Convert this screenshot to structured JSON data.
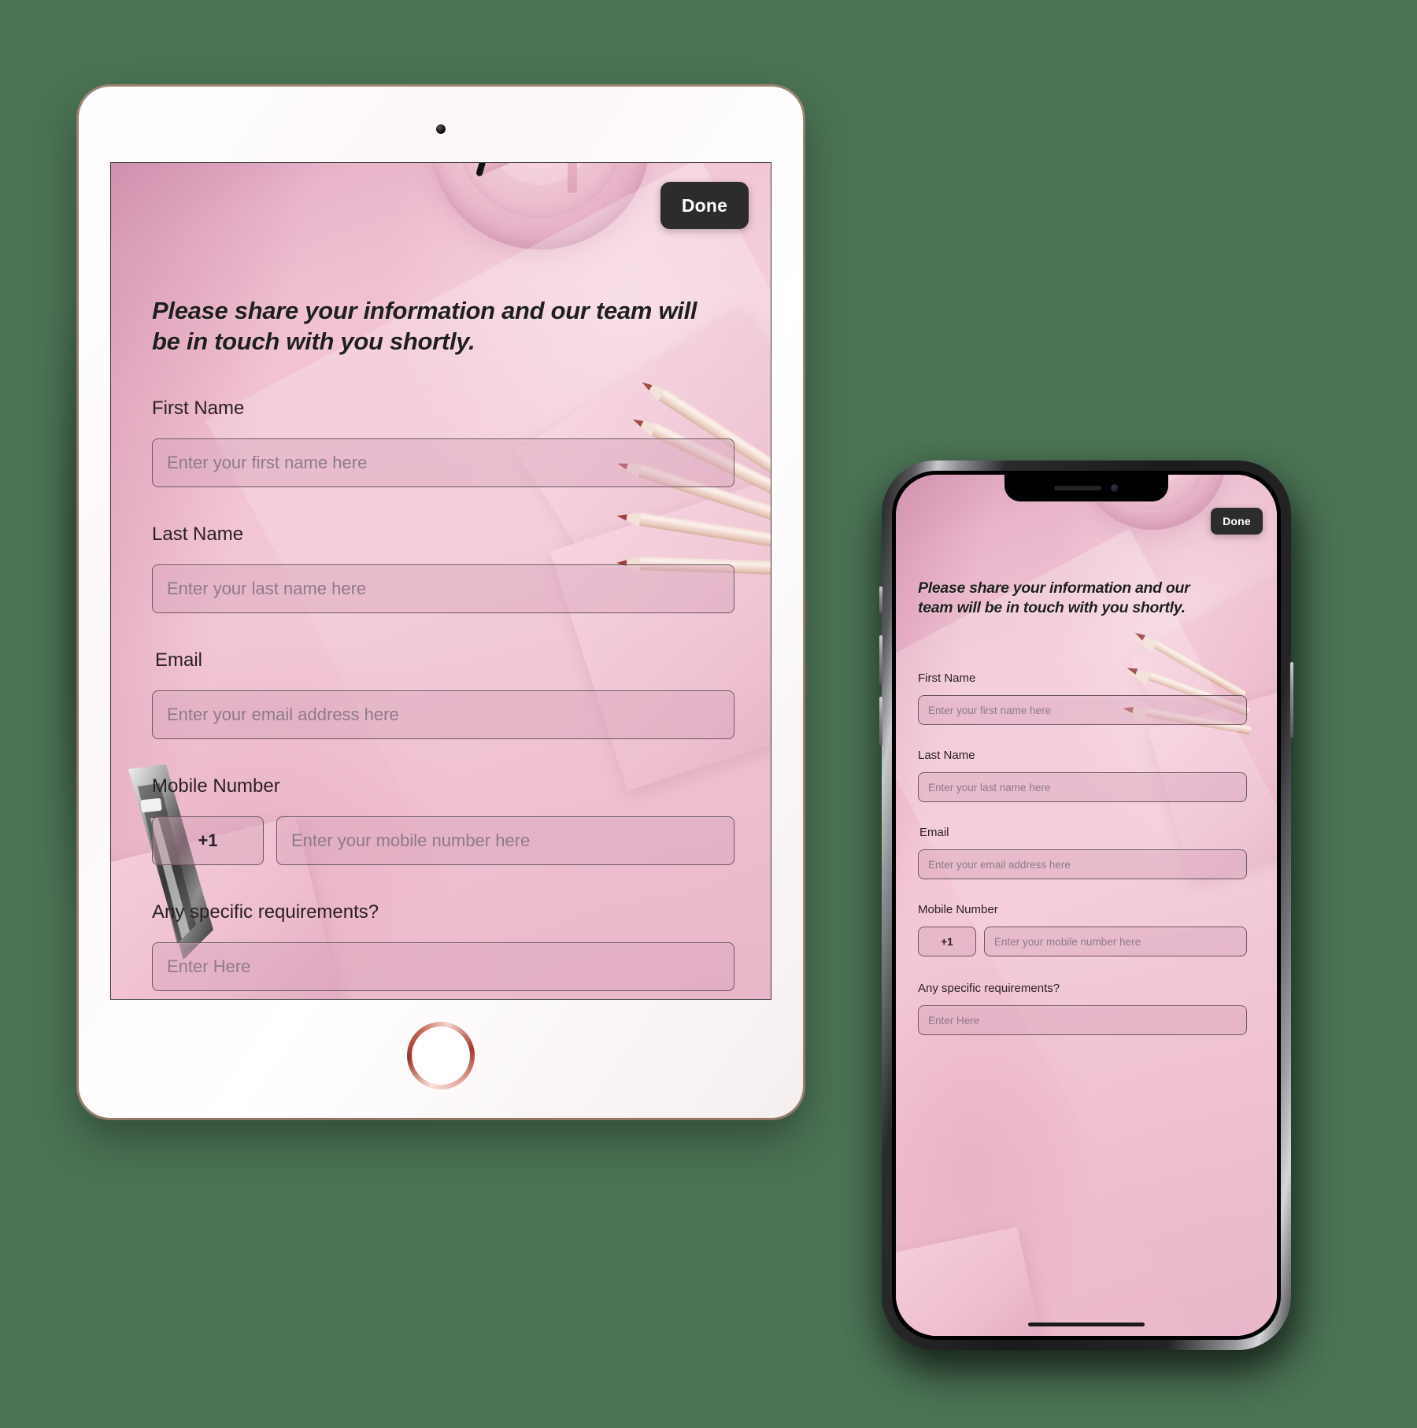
{
  "theme": {
    "background": "#4b7355",
    "accent_pink": "#f2c3d3",
    "deep_pink": "#d9a0bb",
    "button_dark": "#2c2c2c",
    "button_text": "#ffffff",
    "label_text": "#2a2024",
    "placeholder_text": "#8e7b85",
    "input_fill": "rgba(214,163,186,0.42)",
    "input_border": "#6b5560"
  },
  "form": {
    "done_label": "Done",
    "headline": "Please share your information and our team will be in touch with you shortly.",
    "fields": [
      {
        "label": "First Name",
        "placeholder": "Enter your first name here"
      },
      {
        "label": "Last Name",
        "placeholder": "Enter your last name here"
      },
      {
        "label": "Email",
        "placeholder": "Enter your email address here"
      },
      {
        "label": "Mobile Number",
        "country_code": "+1",
        "placeholder": "Enter your mobile number here"
      },
      {
        "label": "Any specific requirements?",
        "placeholder": "Enter Here"
      }
    ]
  },
  "devices": {
    "tablet": {
      "name": "tablet",
      "icons": {
        "camera": "camera-icon",
        "home": "home-button-icon"
      }
    },
    "phone": {
      "name": "phone",
      "icons": {
        "notch_speaker": "speaker-icon",
        "notch_camera": "camera-icon",
        "home_indicator": "home-indicator-icon"
      }
    }
  },
  "decor": {
    "pencils": "colored-pencils-graphic",
    "disc": "pink-round-object-graphic",
    "pen_nib": "fountain-pen-nib-graphic"
  }
}
